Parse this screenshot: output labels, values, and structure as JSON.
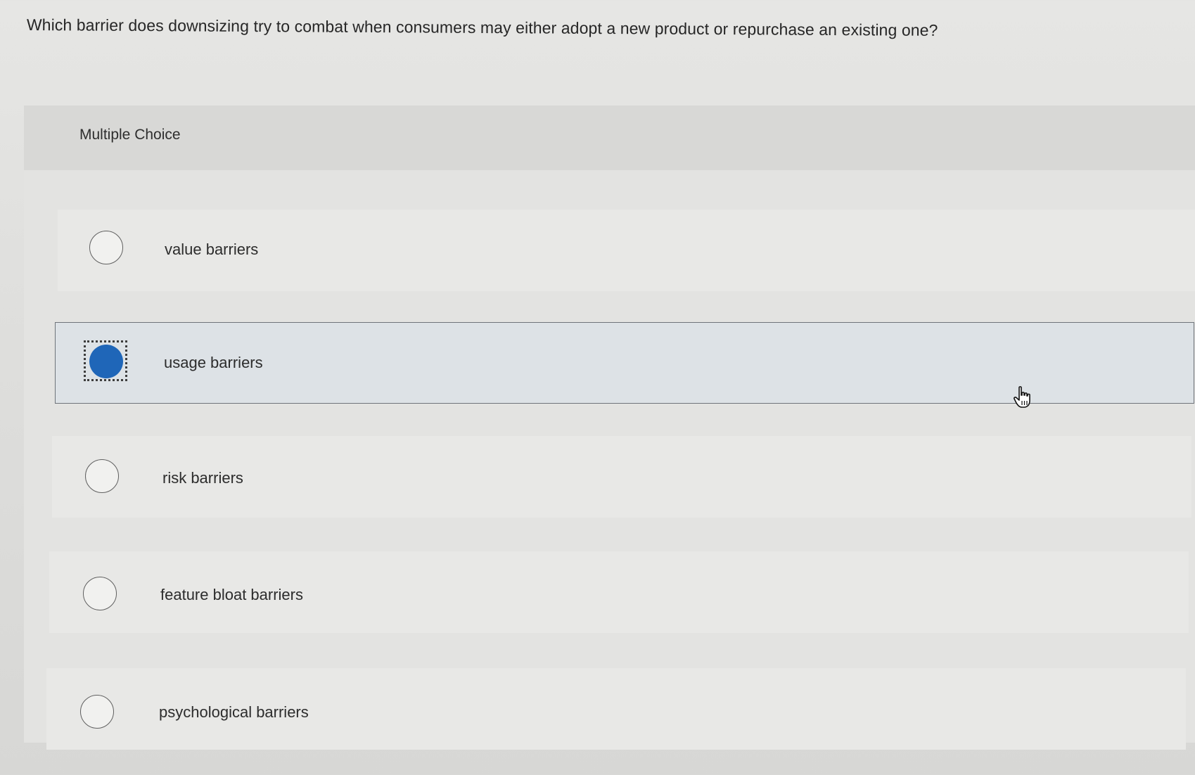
{
  "question": {
    "text": "Which barrier does downsizing try to combat when consumers may either adopt a new product or repurchase an existing one?"
  },
  "panel": {
    "title": "Multiple Choice"
  },
  "options": [
    {
      "label": "value barriers",
      "selected": false
    },
    {
      "label": "usage barriers",
      "selected": true
    },
    {
      "label": "risk barriers",
      "selected": false
    },
    {
      "label": "feature bloat barriers",
      "selected": false
    },
    {
      "label": "psychological barriers",
      "selected": false
    }
  ],
  "colors": {
    "selected_radio": "#1f66b8",
    "selected_row": "#dde2e6"
  },
  "icons": {
    "cursor": "hand-pointer-icon"
  }
}
